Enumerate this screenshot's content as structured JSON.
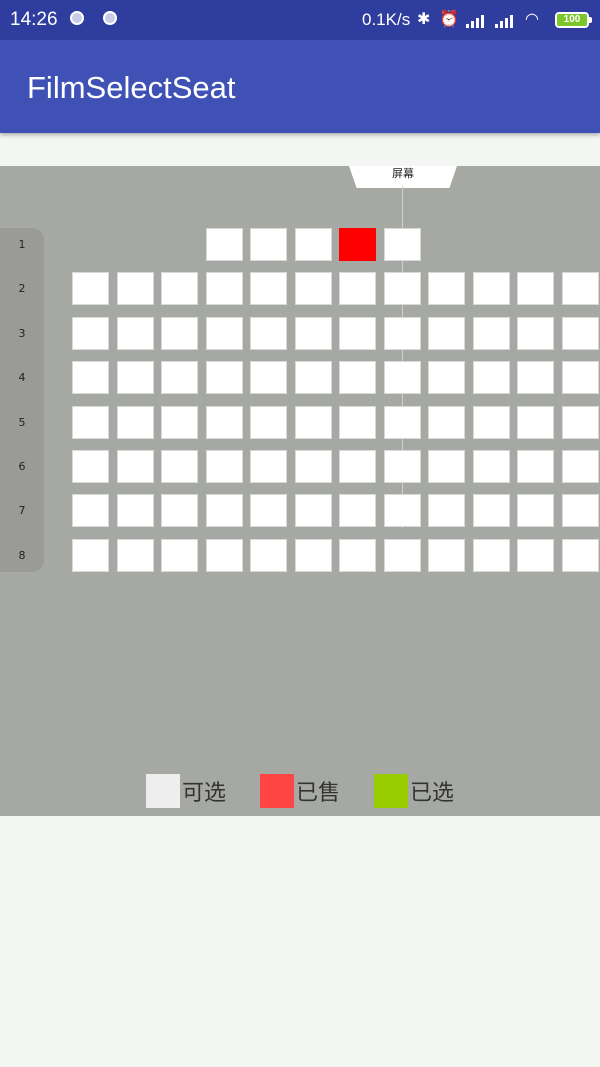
{
  "status_bar": {
    "time": "14:26",
    "speed": "0.1K/s",
    "battery": "100"
  },
  "app": {
    "title": "FilmSelectSeat"
  },
  "screen": {
    "label": "屏幕"
  },
  "rows": [
    {
      "label": "1",
      "seats": [
        "empty",
        "empty",
        "empty",
        "available",
        "available",
        "available",
        "sold",
        "available",
        "empty",
        "empty",
        "empty",
        "empty"
      ]
    },
    {
      "label": "2",
      "seats": [
        "available",
        "available",
        "available",
        "available",
        "available",
        "available",
        "available",
        "available",
        "available",
        "available",
        "available",
        "available"
      ]
    },
    {
      "label": "3",
      "seats": [
        "available",
        "available",
        "available",
        "available",
        "available",
        "available",
        "available",
        "available",
        "available",
        "available",
        "available",
        "available"
      ]
    },
    {
      "label": "4",
      "seats": [
        "available",
        "available",
        "available",
        "available",
        "available",
        "available",
        "available",
        "available",
        "available",
        "available",
        "available",
        "available"
      ]
    },
    {
      "label": "5",
      "seats": [
        "available",
        "available",
        "available",
        "available",
        "available",
        "available",
        "available",
        "available",
        "available",
        "available",
        "available",
        "available"
      ]
    },
    {
      "label": "6",
      "seats": [
        "available",
        "available",
        "available",
        "available",
        "available",
        "available",
        "available",
        "available",
        "available",
        "available",
        "available",
        "available"
      ]
    },
    {
      "label": "7",
      "seats": [
        "available",
        "available",
        "available",
        "available",
        "available",
        "available",
        "available",
        "available",
        "available",
        "available",
        "available",
        "available"
      ]
    },
    {
      "label": "8",
      "seats": [
        "available",
        "available",
        "available",
        "available",
        "available",
        "available",
        "available",
        "available",
        "available",
        "available",
        "available",
        "available"
      ]
    }
  ],
  "legend": [
    {
      "label": "可选",
      "color": "#eeeeee"
    },
    {
      "label": "已售",
      "color": "#ff4444"
    },
    {
      "label": "已选",
      "color": "#99cc00"
    }
  ]
}
